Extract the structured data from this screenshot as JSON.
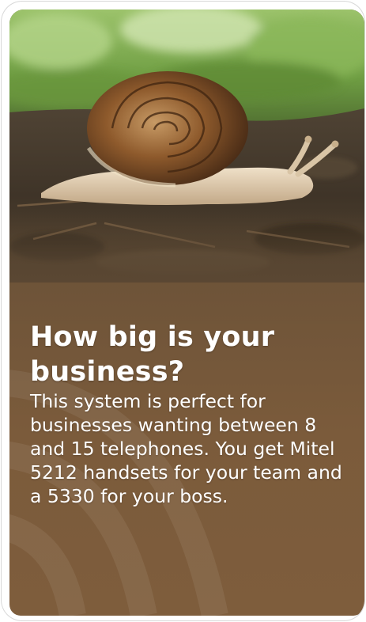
{
  "card": {
    "image_icon": "snail-photo",
    "heading": "How big is your business?",
    "body": "This system is perfect for businesses wanting between 8 and 15 telephones.  You get Mitel 5212 handsets for your team and a 5330 for your boss."
  },
  "colors": {
    "panel_top": "#5a4733",
    "panel_bottom": "#7e5d3c",
    "text": "#ffffff",
    "card_border": "#d8d8d8"
  }
}
